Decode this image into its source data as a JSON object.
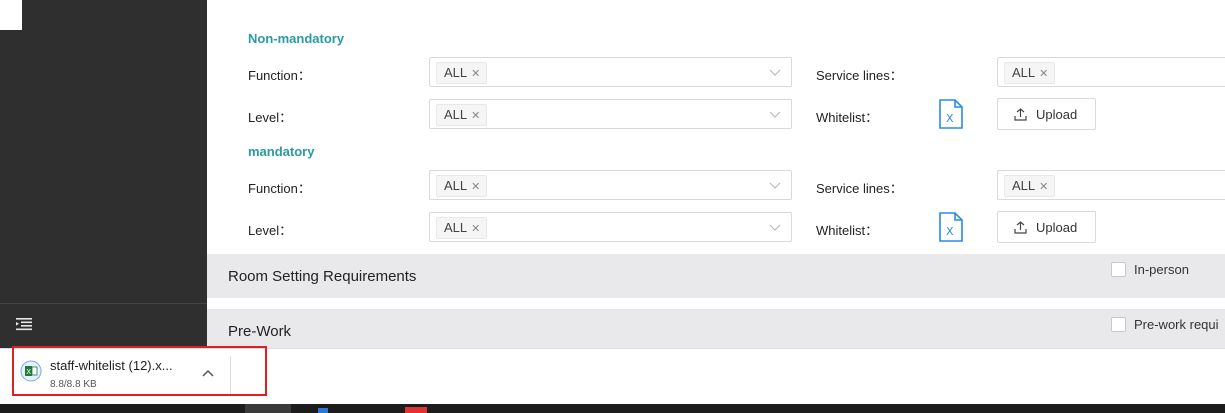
{
  "non_mandatory": {
    "title": "Non-mandatory",
    "function_label": "Function：",
    "function_value": "ALL",
    "level_label": "Level：",
    "level_value": "ALL",
    "service_lines_label": "Service lines：",
    "service_lines_value": "ALL",
    "whitelist_label": "Whitelist：",
    "upload_label": "Upload"
  },
  "mandatory": {
    "title": "mandatory",
    "function_label": "Function：",
    "function_value": "ALL",
    "level_label": "Level：",
    "level_value": "ALL",
    "service_lines_label": "Service lines：",
    "service_lines_value": "ALL",
    "whitelist_label": "Whitelist：",
    "upload_label": "Upload"
  },
  "room_setting": {
    "title": "Room Setting Requirements",
    "checkbox_label": "In-person"
  },
  "pre_work": {
    "title": "Pre-Work",
    "checkbox_label": "Pre-work requi"
  },
  "download": {
    "file_name": "staff-whitelist (12).x...",
    "file_size": "8.8/8.8 KB"
  },
  "colors": {
    "section_title": "#2a9aa3",
    "highlight_border": "#e02020",
    "excel_icon": "#2b8ae6"
  },
  "icons": [
    "collapse-menu-icon",
    "chevron-down-icon",
    "excel-file-icon",
    "upload-icon",
    "remove-tag-icon",
    "excel-download-icon",
    "chevron-up-icon"
  ]
}
